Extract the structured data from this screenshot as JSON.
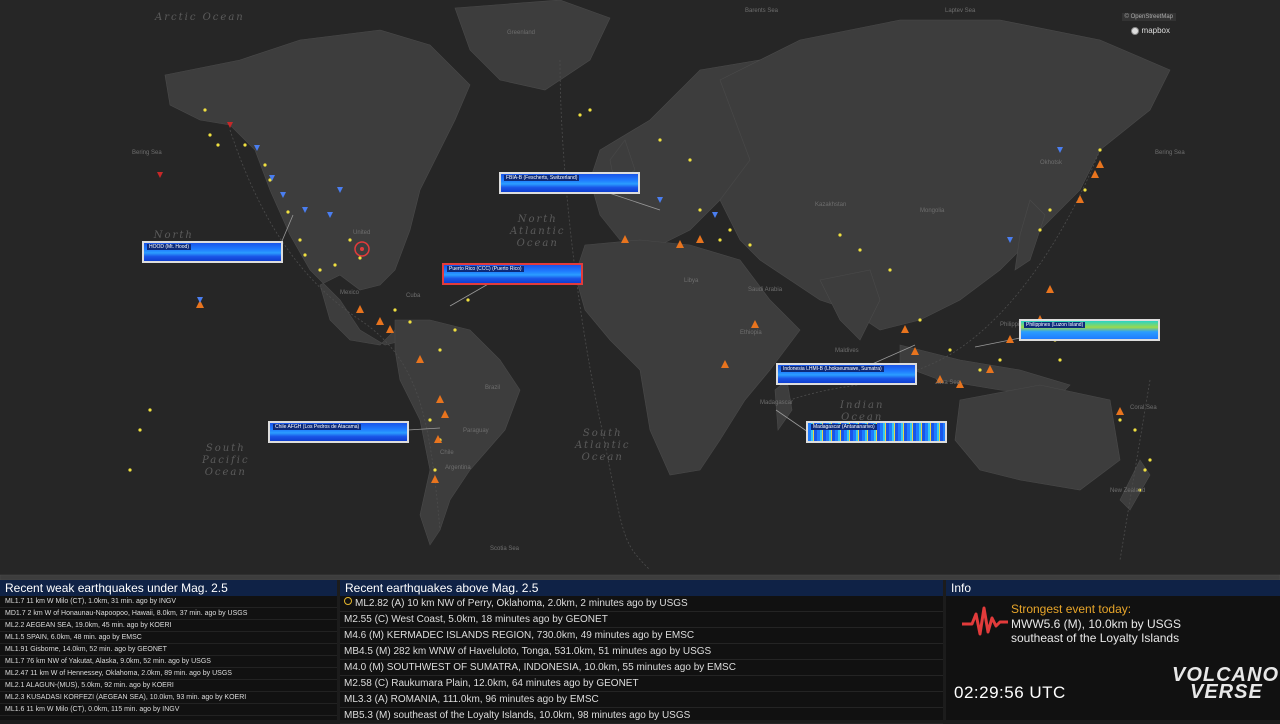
{
  "map": {
    "ocean_labels": [
      {
        "id": "arctic",
        "text": "Arctic Ocean"
      },
      {
        "id": "north-pacific",
        "text": "North\nPacific\nOcean"
      },
      {
        "id": "north-atlantic",
        "text": "North\nAtlantic\nOcean"
      },
      {
        "id": "south-pacific",
        "text": "South\nPacific\nOcean"
      },
      {
        "id": "south-atlantic",
        "text": "South\nAtlantic\nOcean"
      },
      {
        "id": "indian",
        "text": "Indian\nOcean"
      }
    ],
    "place_labels": [
      "Greenland",
      "Bering Sea",
      "Bering Sea",
      "United",
      "Mexico",
      "Cuba",
      "Brazil",
      "Paraguay",
      "Argentina",
      "Scotia Sea",
      "Chile",
      "Libya",
      "Saudi Arabia",
      "Ethiopia",
      "Madagascar",
      "Maldives",
      "Kazakhstan",
      "Mongolia",
      "Philippines",
      "New Zealand",
      "Coral Sea",
      "Java Sea",
      "Barents Sea",
      "Laptev Sea",
      "Okhotsk"
    ],
    "credits": "© OpenStreetMap",
    "mapbox_label": "mapbox",
    "colors": {
      "volcano": "#e8741e",
      "eq_weak": "#f0e040",
      "eq_blue": "#4a7ef0",
      "eq_red": "#c62828"
    }
  },
  "seismograms": [
    {
      "id": "us",
      "label": "HOOD (Mt. Hood)",
      "style": "blue"
    },
    {
      "id": "swiss",
      "label": "FBIA-B (Fescherts, Switzerland)",
      "style": "blue"
    },
    {
      "id": "pr",
      "label": "Puerto Rico (CCC) (Puerto Rico)",
      "style": "red"
    },
    {
      "id": "chile",
      "label": "Chile AFGH (Los Pedros de Atacama)",
      "style": "blue"
    },
    {
      "id": "philippines",
      "label": "Philippines (Luzon Island)",
      "style": "green"
    },
    {
      "id": "indonesia",
      "label": "Indonesia LHMI-B (Lhokseumawe, Sumatra)",
      "style": "blue"
    },
    {
      "id": "madagascar",
      "label": "Madagascar (Antananarivo)",
      "style": "mad"
    }
  ],
  "weak": {
    "title": "Recent weak earthquakes under Mag. 2.5",
    "rows": [
      "ML1.7 11 km W Milo (CT), 1.0km, 31 min. ago by INGV",
      "MD1.7 2 km W of Honaunau-Napoopoo, Hawaii, 8.0km, 37 min. ago by USGS",
      "ML2.2 AEGEAN SEA, 19.0km, 45 min. ago by KOERI",
      "ML1.5 SPAIN, 6.0km, 48 min. ago by EMSC",
      "ML1.91 Gisborne, 14.0km, 52 min. ago by GEONET",
      "ML1.7 76 km NW of Yakutat, Alaska, 9.0km, 52 min. ago by USGS",
      "ML2.47 11 km W of Hennessey, Oklahoma, 2.0km, 89 min. ago by USGS",
      "ML2.1 ALAGUN-(MUS), 5.0km, 92 min. ago by KOERI",
      "ML2.3 KUSADASI KORFEZI (AEGEAN SEA), 10.0km, 93 min. ago by KOERI",
      "ML1.6 11 km W Milo (CT), 0.0km, 115 min. ago by INGV"
    ]
  },
  "strong": {
    "title": "Recent earthquakes above Mag. 2.5",
    "rows": [
      "ML2.82 (A) 10 km NW of Perry, Oklahoma, 2.0km, 2 minutes ago by USGS",
      "M2.55 (C) West Coast, 5.0km, 18 minutes ago by GEONET",
      "M4.6 (M) KERMADEC ISLANDS REGION, 730.0km, 49 minutes ago by EMSC",
      "MB4.5 (M) 282 km WNW of Haveluloto, Tonga, 531.0km, 51 minutes ago by USGS",
      "M4.0 (M) SOUTHWEST OF SUMATRA, INDONESIA, 10.0km, 55 minutes ago by EMSC",
      "M2.58 (C) Raukumara Plain, 12.0km, 64 minutes ago by GEONET",
      "ML3.3 (A) ROMANIA, 111.0km, 96 minutes ago by EMSC",
      "MB5.3 (M) southeast of the Loyalty Islands, 10.0km, 98 minutes ago by USGS"
    ]
  },
  "info": {
    "title": "Info",
    "strongest_title": "Strongest event today:",
    "strongest_line1": "MWW5.6 (M), 10.0km by USGS",
    "strongest_line2": "southeast of the Loyalty Islands",
    "clock": "02:29:56 UTC",
    "brand_top": "VOLCANO",
    "brand_bottom": "VERSE"
  }
}
